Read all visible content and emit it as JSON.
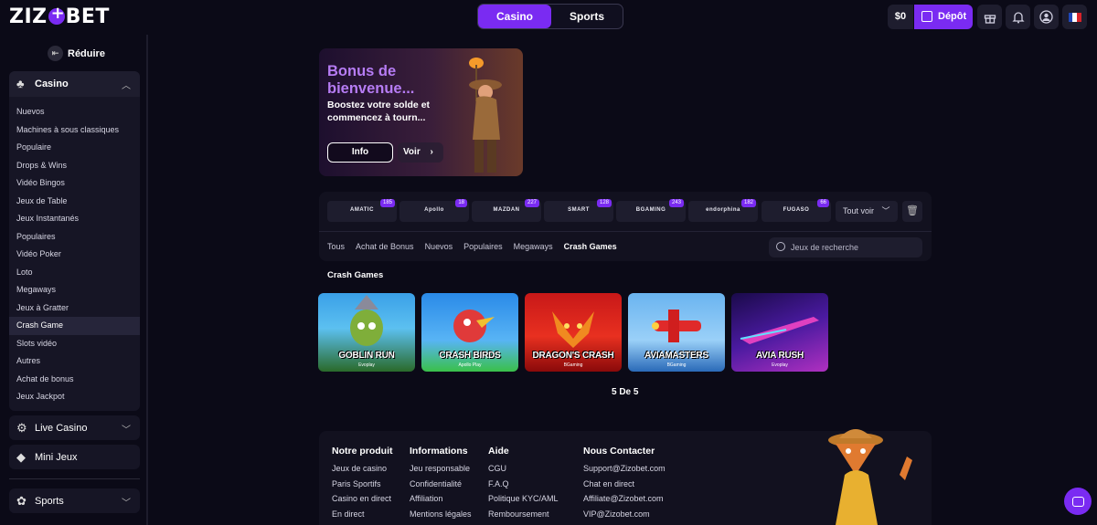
{
  "header": {
    "logo": "ZIZOBET",
    "modes": [
      "Casino",
      "Sports"
    ],
    "balance": "$0",
    "deposit_label": "Dépôt",
    "icons": [
      "gift-icon",
      "bell-icon",
      "user-icon",
      "france-flag-icon"
    ],
    "colors": {
      "accent": "#7a2bf2",
      "bg": "#0b0a17",
      "panel": "#12111f"
    }
  },
  "sidebar": {
    "reduce_label": "Réduire",
    "casino_label": "Casino",
    "items": [
      "Nuevos",
      "Machines à sous classiques",
      "Populaire",
      "Drops & Wins",
      "Vidéo Bingos",
      "Jeux de Table",
      "Jeux Instantanés",
      "Populaires",
      "Vidéo Poker",
      "Loto",
      "Megaways",
      "Jeux à Gratter",
      "Crash Game",
      "Slots vidéo",
      "Autres",
      "Achat de bonus",
      "Jeux Jackpot"
    ],
    "active_item": "Crash Game",
    "sections": [
      "Live Casino",
      "Mini Jeux",
      "Sports"
    ]
  },
  "banner": {
    "title": "Bonus de bienvenue...",
    "subtitle": "Boostez votre solde et commencez à tourn...",
    "info_label": "Info",
    "voir_label": "Voir"
  },
  "providers": [
    {
      "name": "AMATIC",
      "count": "185"
    },
    {
      "name": "Apollo",
      "count": "18"
    },
    {
      "name": "MAZDAN",
      "count": "227"
    },
    {
      "name": "SMART",
      "count": "128"
    },
    {
      "name": "BGAMING",
      "count": "243"
    },
    {
      "name": "endorphina",
      "count": "182"
    },
    {
      "name": "FUGASO",
      "count": "66"
    }
  ],
  "provider_controls": {
    "tout_voir": "Tout voir"
  },
  "categories": [
    "Tous",
    "Achat de Bonus",
    "Nuevos",
    "Populaires",
    "Megaways",
    "Crash Games"
  ],
  "active_category": "Crash Games",
  "search": {
    "placeholder": "Jeux de recherche"
  },
  "section_title": "Crash Games",
  "games": [
    {
      "name": "GOBLIN RUN",
      "provider": "Evoplay"
    },
    {
      "name": "CRASH BIRDS",
      "provider": "Apollo Play"
    },
    {
      "name": "DRAGON'S CRASH",
      "provider": "BGaming"
    },
    {
      "name": "AVIAMASTERS",
      "provider": "BGaming"
    },
    {
      "name": "AVIA RUSH",
      "provider": "Evoplay"
    }
  ],
  "pager": "5 De 5",
  "footer": {
    "columns": [
      {
        "title": "Notre produit",
        "links": [
          "Jeux de casino",
          "Paris Sportifs",
          "Casino en direct",
          "En direct"
        ]
      },
      {
        "title": "Informations",
        "links": [
          "Jeu responsable",
          "Confidentialité",
          "Affiliation",
          "Mentions légales"
        ]
      },
      {
        "title": "Aide",
        "links": [
          "CGU",
          "F.A.Q",
          "Politique KYC/AML",
          "Remboursement"
        ]
      },
      {
        "title": "Nous Contacter",
        "links": [
          "Support@Zizobet.com",
          "Chat en direct",
          "Affiliate@Zizobet.com",
          "VIP@Zizobet.com"
        ]
      }
    ]
  }
}
